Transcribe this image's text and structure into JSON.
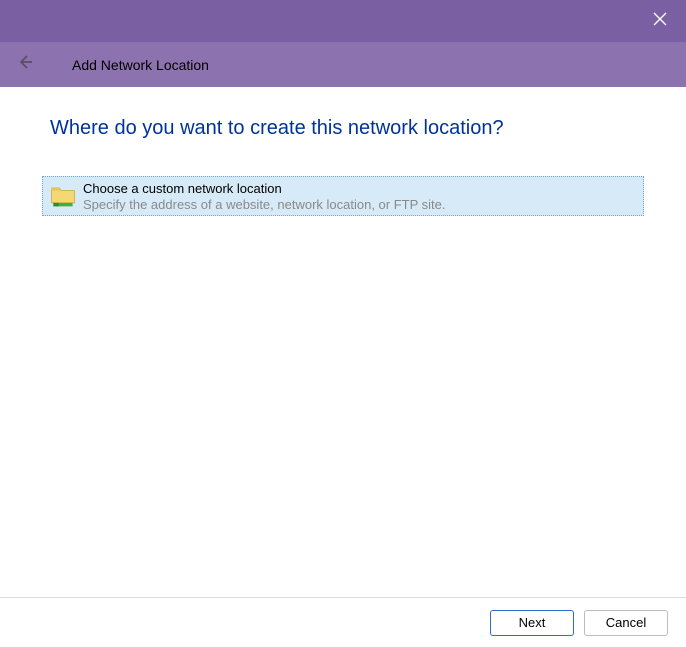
{
  "titlebar": {
    "close_label": "Close"
  },
  "header": {
    "back_label": "Back",
    "title": "Add Network Location"
  },
  "main": {
    "heading": "Where do you want to create this network location?",
    "option": {
      "title": "Choose a custom network location",
      "description": "Specify the address of a website, network location, or FTP site."
    }
  },
  "footer": {
    "next_label": "Next",
    "cancel_label": "Cancel"
  }
}
